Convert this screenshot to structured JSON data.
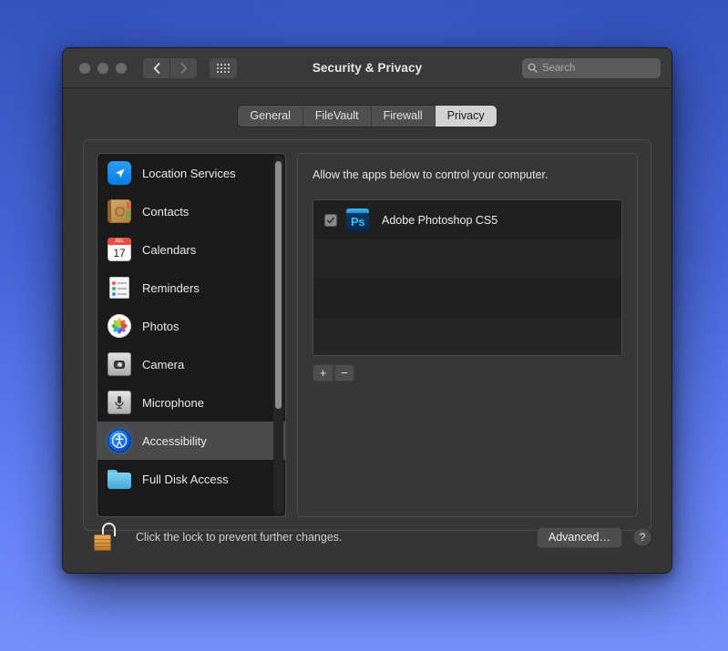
{
  "window": {
    "title": "Security & Privacy",
    "traffic_lights": [
      "close-button",
      "minimize-button",
      "zoom-button"
    ],
    "nav": {
      "back": "‹",
      "forward": "›",
      "grid": "show-all-icon"
    },
    "search": {
      "value": "",
      "placeholder": "Search"
    }
  },
  "tabs": [
    {
      "label": "General",
      "active": false
    },
    {
      "label": "FileVault",
      "active": false
    },
    {
      "label": "Firewall",
      "active": false
    },
    {
      "label": "Privacy",
      "active": true
    }
  ],
  "sidebar": {
    "items": [
      {
        "label": "Location Services",
        "icon": "location-services-icon",
        "selected": false
      },
      {
        "label": "Contacts",
        "icon": "contacts-icon",
        "selected": false
      },
      {
        "label": "Calendars",
        "icon": "calendars-icon",
        "selected": false
      },
      {
        "label": "Reminders",
        "icon": "reminders-icon",
        "selected": false
      },
      {
        "label": "Photos",
        "icon": "photos-icon",
        "selected": false
      },
      {
        "label": "Camera",
        "icon": "camera-icon",
        "selected": false
      },
      {
        "label": "Microphone",
        "icon": "microphone-icon",
        "selected": false
      },
      {
        "label": "Accessibility",
        "icon": "accessibility-icon",
        "selected": true
      },
      {
        "label": "Full Disk Access",
        "icon": "full-disk-access-icon",
        "selected": false
      }
    ],
    "calendar_icon": {
      "month": "JUL",
      "day": "17"
    }
  },
  "detail": {
    "description": "Allow the apps below to control your computer.",
    "apps": [
      {
        "name": "Adobe Photoshop CS5",
        "checked": true,
        "icon": "photoshop-icon",
        "badge": "Ps"
      }
    ],
    "empty_rows": 3,
    "add_button": "+",
    "remove_button": "−"
  },
  "footer": {
    "lock_icon": "unlocked-padlock-icon",
    "lock_message": "Click the lock to prevent further changes.",
    "advanced_label": "Advanced…",
    "help_label": "?"
  },
  "colors": {
    "desktop_top": "#3353bd",
    "desktop_bottom": "#7490fb",
    "window_bg": "#353535",
    "active_tab_bg": "#d2d2d2",
    "selected_row_bg": "#4a4a4a",
    "list_bg": "#202020",
    "accent_blue": "#0a7ce0",
    "lock_gold": "#d9973e"
  }
}
